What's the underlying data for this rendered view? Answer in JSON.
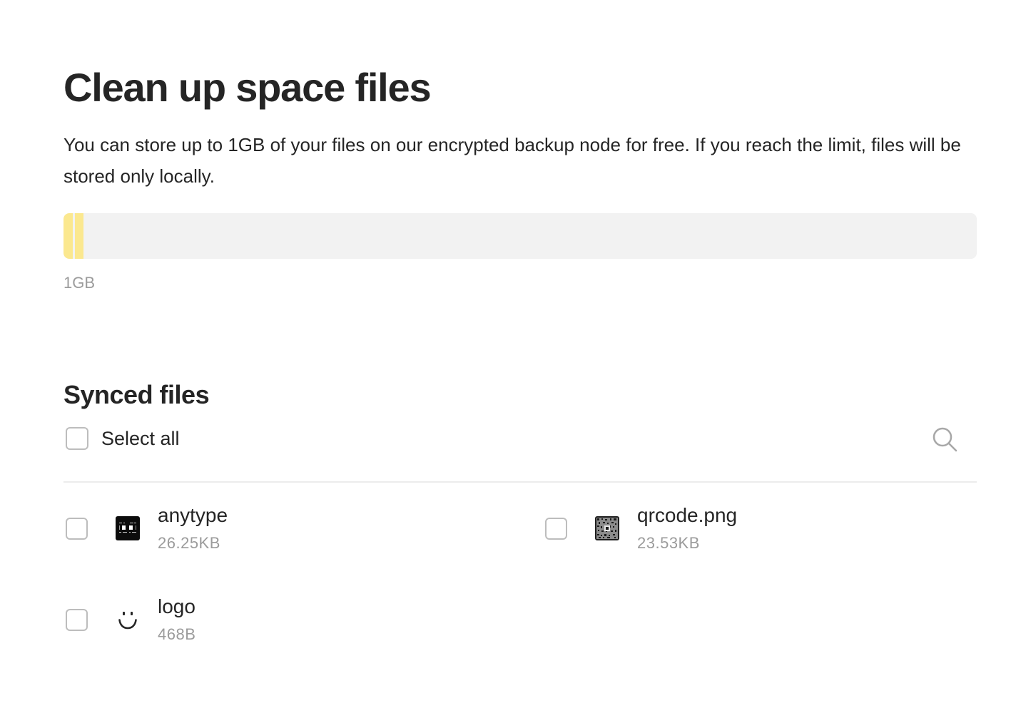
{
  "header": {
    "title": "Clean up space files",
    "description": "You can store up to 1GB of your files on our encrypted backup node for free. If you reach the limit, files will be stored only locally."
  },
  "usage": {
    "limit_label": "1GB",
    "segments": [
      {
        "fraction": 0.0102,
        "color": "#fbe88f"
      },
      {
        "fraction": 0.0095,
        "color": "#fbe88f"
      }
    ],
    "track_color": "#f2f2f2"
  },
  "synced": {
    "title": "Synced files",
    "select_all_label": "Select all",
    "search_icon": "search-icon",
    "files": [
      {
        "name": "anytype",
        "size": "26.25KB",
        "thumbnail": "anytype-image-thumbnail",
        "checked": false
      },
      {
        "name": "qrcode.png",
        "size": "23.53KB",
        "thumbnail": "qrcode-image-thumbnail",
        "checked": false
      },
      {
        "name": "logo",
        "size": "468B",
        "thumbnail": "smiley-logo-icon",
        "checked": false
      }
    ]
  },
  "colors": {
    "text": "#252525",
    "muted": "#9b9b9b",
    "usage_fill": "#fbe88f",
    "checkbox_border": "#bdbdbd",
    "divider": "#ececec"
  }
}
